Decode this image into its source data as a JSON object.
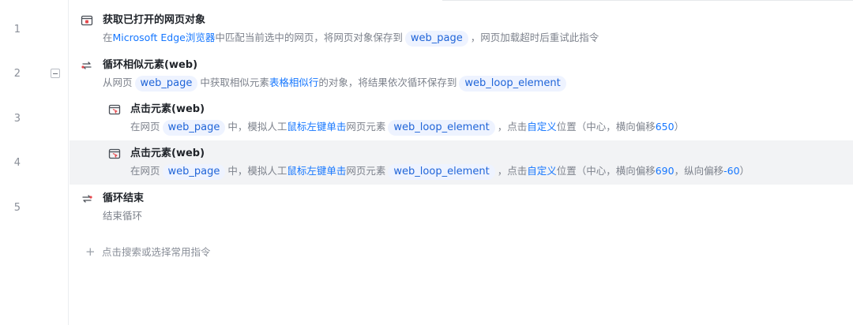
{
  "line_numbers": [
    "1",
    "2",
    "3",
    "4",
    "5"
  ],
  "steps": [
    {
      "title": "获取已打开的网页对象",
      "desc": {
        "t1": "在",
        "h1": "Microsoft Edge浏览器",
        "t2": "中匹配当前选中的网页，将网页对象保存到",
        "v1": "web_page",
        "t3": "，网页加载超时后重试此指令"
      }
    },
    {
      "title": "循环相似元素(web)",
      "desc": {
        "t1": "从网页",
        "v1": "web_page",
        "t2": "中获取相似元素",
        "h1": "表格相似行",
        "t3": "的对象，将结果依次循环保存到",
        "v2": "web_loop_element"
      }
    },
    {
      "title": "点击元素(web)",
      "desc": {
        "t1": "在网页",
        "v1": "web_page",
        "t2": "中，模拟人工",
        "h1": "鼠标左键单击",
        "t3": "网页元素",
        "v2": "web_loop_element",
        "t4": "，点击",
        "h2": "自定义",
        "t5": "位置（中心，横向偏移",
        "h3": "650",
        "t6": "）"
      }
    },
    {
      "title": "点击元素(web)",
      "desc": {
        "t1": "在网页",
        "v1": "web_page",
        "t2": "中，模拟人工",
        "h1": "鼠标左键单击",
        "t3": "网页元素",
        "v2": "web_loop_element",
        "t4": "，点击",
        "h2": "自定义",
        "t5": "位置（中心，横向偏移",
        "h3": "690",
        "t6": "，纵向偏移",
        "h4": "-60",
        "t7": "）"
      }
    },
    {
      "title": "循环结束",
      "desc": {
        "t1": "结束循环"
      }
    }
  ],
  "add_command": {
    "label": "点击搜索或选择常用指令"
  },
  "colors": {
    "accent": "#1677ff",
    "var_bg": "#eef3ff",
    "selected_row": "#f2f3f5"
  }
}
